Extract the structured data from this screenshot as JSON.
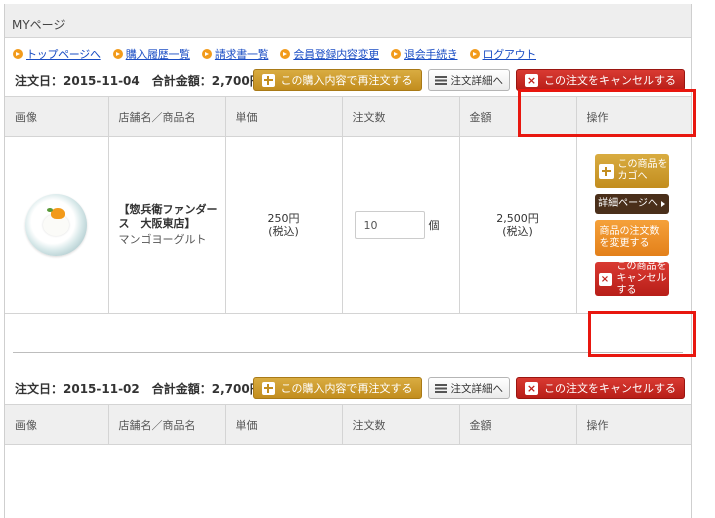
{
  "page": {
    "title": "MYページ"
  },
  "nav": [
    {
      "label": "トップページへ"
    },
    {
      "label": "購入履歴一覧"
    },
    {
      "label": "請求書一覧"
    },
    {
      "label": "会員登録内容変更"
    },
    {
      "label": "退会手続き"
    },
    {
      "label": "ログアウト"
    }
  ],
  "orders": [
    {
      "info": "注文日：2015-11-04　合計金額：2,700円",
      "reorder_label": "この購入内容で再注文する",
      "detail_label": "注文詳細へ",
      "cancel_label": "この注文をキャンセルする"
    },
    {
      "info": "注文日：2015-11-02　合計金額：2,700円",
      "reorder_label": "この購入内容で再注文する",
      "detail_label": "注文詳細へ",
      "cancel_label": "この注文をキャンセルする"
    }
  ],
  "table": {
    "headers": [
      "画像",
      "店舗名／商品名",
      "単価",
      "注文数",
      "金額",
      "操作"
    ]
  },
  "item": {
    "shop": "【惣兵衛ファンダース　大阪東店】",
    "product": "マンゴヨーグルト",
    "unit_price": "250円",
    "tax_note": "(税込)",
    "quantity": "10",
    "quantity_unit": "個",
    "amount": "2,500円",
    "amount_tax_note": "(税込)"
  },
  "ops": {
    "add_to_cart": "この商品を カゴへ",
    "detail_page": "詳細ページへ",
    "change_quantity": "商品の注文数 を変更する",
    "cancel_item": "この商品を キャンセルする"
  },
  "colors": {
    "accent_orange": "#f29b1b",
    "gold_button": "#c28d1e",
    "red_button": "#b81e18",
    "highlight_red": "#e8170f",
    "link_blue": "#1a4dc4"
  }
}
